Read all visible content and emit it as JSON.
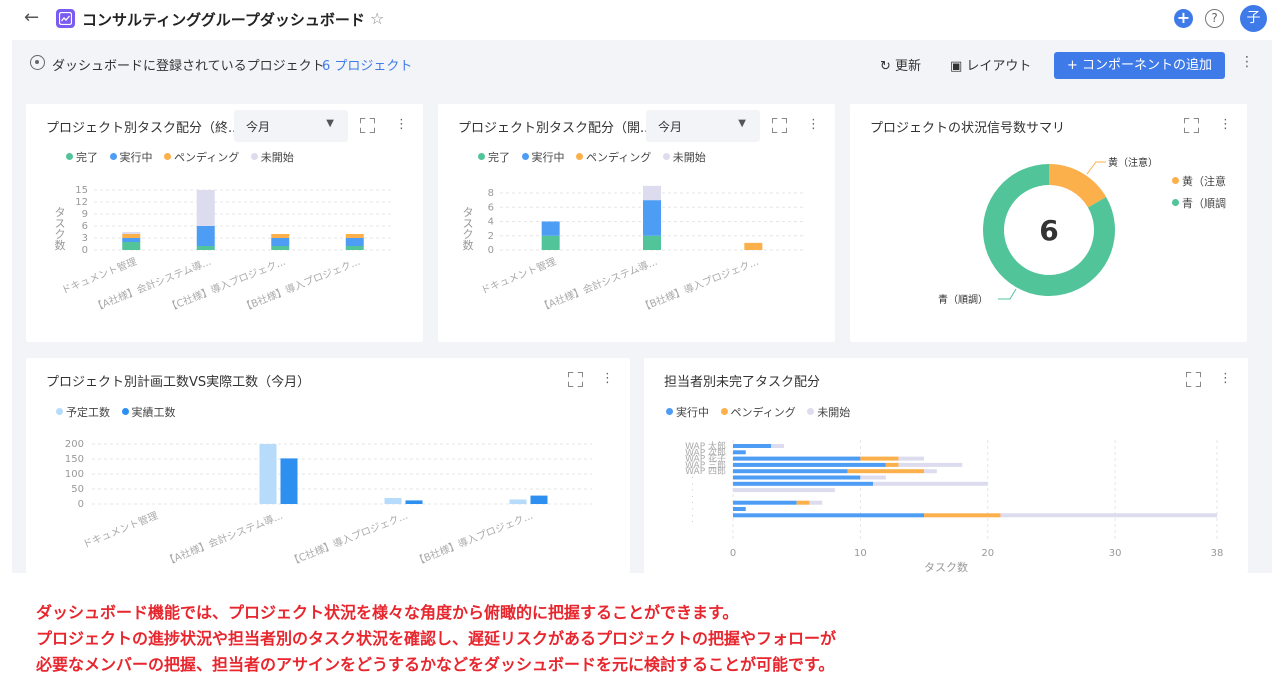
{
  "header": {
    "title": "コンサルティンググループダッシュボード",
    "avatar_initial": "子",
    "help_glyph": "?"
  },
  "toolbar": {
    "registered_label": "ダッシュボードに登録されているプロジェクト",
    "registered_count": "6 プロジェクト",
    "refresh_label": "更新",
    "layout_label": "レイアウト",
    "add_component_label": "+ コンポーネントの追加"
  },
  "colors": {
    "done": "#52c49a",
    "in_progress": "#4e9df5",
    "pending": "#fbb04b",
    "not_started": "#dcdcee",
    "planned": "#b7dbfb",
    "actual": "#2d8ff0",
    "status_green": "#52c49a",
    "status_yellow": "#fbb04b"
  },
  "cards": {
    "task_done": {
      "title": "プロジェクト別タスク配分（終...",
      "select_value": "今月",
      "legend": [
        "完了",
        "実行中",
        "ペンディング",
        "未開始"
      ]
    },
    "task_start": {
      "title": "プロジェクト別タスク配分（開...",
      "select_value": "今月",
      "legend": [
        "完了",
        "実行中",
        "ペンディング",
        "未開始"
      ]
    },
    "status_summary": {
      "title": "プロジェクトの状況信号数サマリ",
      "center_value": "6",
      "legend": [
        "黄（注意",
        "青（順調"
      ]
    },
    "plan_actual": {
      "title": "プロジェクト別計画工数VS実際工数（今月）",
      "legend": [
        "予定工数",
        "実績工数"
      ]
    },
    "assignee": {
      "title": "担当者別未完了タスク配分",
      "legend": [
        "実行中",
        "ペンディング",
        "未開始"
      ]
    }
  },
  "chart_data": [
    {
      "id": "task_done",
      "type": "bar",
      "stacked": true,
      "ylabel": "タスク数",
      "ylim": [
        0,
        15
      ],
      "yticks": [
        0,
        3,
        6,
        9,
        12,
        15
      ],
      "categories": [
        "ドキュメント管理",
        "【A社様】会計システム導...",
        "【C社様】導入プロジェク...",
        "【B社様】導入プロジェク..."
      ],
      "series": [
        {
          "name": "完了",
          "values": [
            2,
            1,
            1,
            1
          ]
        },
        {
          "name": "実行中",
          "values": [
            1,
            5,
            2,
            2
          ]
        },
        {
          "name": "ペンディング",
          "values": [
            1,
            0,
            1,
            1
          ]
        },
        {
          "name": "未開始",
          "values": [
            0.5,
            9,
            0,
            0
          ]
        }
      ],
      "legend_position": "top-left",
      "grid": true
    },
    {
      "id": "task_start",
      "type": "bar",
      "stacked": true,
      "ylabel": "タスク数",
      "ylim": [
        0,
        8
      ],
      "yticks": [
        0,
        2,
        4,
        6,
        8
      ],
      "categories": [
        "ドキュメント管理",
        "【A社様】会計システム導...",
        "【B社様】導入プロジェク..."
      ],
      "series": [
        {
          "name": "完了",
          "values": [
            2,
            2,
            0
          ]
        },
        {
          "name": "実行中",
          "values": [
            2,
            5,
            0
          ]
        },
        {
          "name": "ペンディング",
          "values": [
            0,
            0,
            1
          ]
        },
        {
          "name": "未開始",
          "values": [
            0,
            2,
            0
          ]
        }
      ],
      "legend_position": "top-left",
      "grid": true
    },
    {
      "id": "status_summary",
      "type": "pie",
      "donut": true,
      "slices": [
        {
          "name": "黄（注意）",
          "value": 1
        },
        {
          "name": "青（順調）",
          "value": 5
        }
      ],
      "legend_position": "right"
    },
    {
      "id": "plan_actual",
      "type": "bar",
      "ylim": [
        0,
        200
      ],
      "yticks": [
        0,
        50,
        100,
        150,
        200
      ],
      "categories": [
        "ドキュメント管理",
        "【A社様】会計システム導...",
        "【C社様】導入プロジェク...",
        "【B社様】導入プロジェク..."
      ],
      "series": [
        {
          "name": "予定工数",
          "values": [
            0,
            200,
            20,
            15
          ]
        },
        {
          "name": "実績工数",
          "values": [
            0,
            152,
            12,
            28
          ]
        }
      ],
      "legend_position": "top-left",
      "grid": true
    },
    {
      "id": "assignee",
      "type": "bar",
      "orientation": "horizontal",
      "stacked": true,
      "xlabel": "タスク数",
      "xlim": [
        0,
        38
      ],
      "xticks": [
        0,
        10,
        20,
        30,
        38
      ],
      "categories": [
        "WAP 太郎",
        "WAP 次郎",
        "WAP 花子",
        "WAP 三郎",
        "WAP 四郎",
        "",
        "",
        "",
        "",
        "",
        "",
        "",
        ""
      ],
      "series": [
        {
          "name": "実行中",
          "values": [
            3,
            1,
            10,
            12,
            9,
            10,
            11,
            0,
            0,
            5,
            1,
            15,
            0
          ]
        },
        {
          "name": "ペンディング",
          "values": [
            0,
            0,
            3,
            1,
            6,
            0,
            0,
            0,
            0,
            1,
            0,
            6,
            0
          ]
        },
        {
          "name": "未開始",
          "values": [
            1,
            0,
            2,
            5,
            1,
            2,
            9,
            8,
            0,
            1,
            0,
            17,
            0
          ]
        }
      ],
      "legend_position": "top-left",
      "grid": true
    }
  ],
  "caption": [
    "ダッシュボード機能では、プロジェクト状況を様々な角度から俯瞰的に把握することができます。",
    "プロジェクトの進捗状況や担当者別のタスク状況を確認し、遅延リスクがあるプロジェクトの把握やフォローが",
    "必要なメンバーの把握、担当者のアサインをどうするかなどをダッシュボードを元に検討することが可能です。"
  ]
}
